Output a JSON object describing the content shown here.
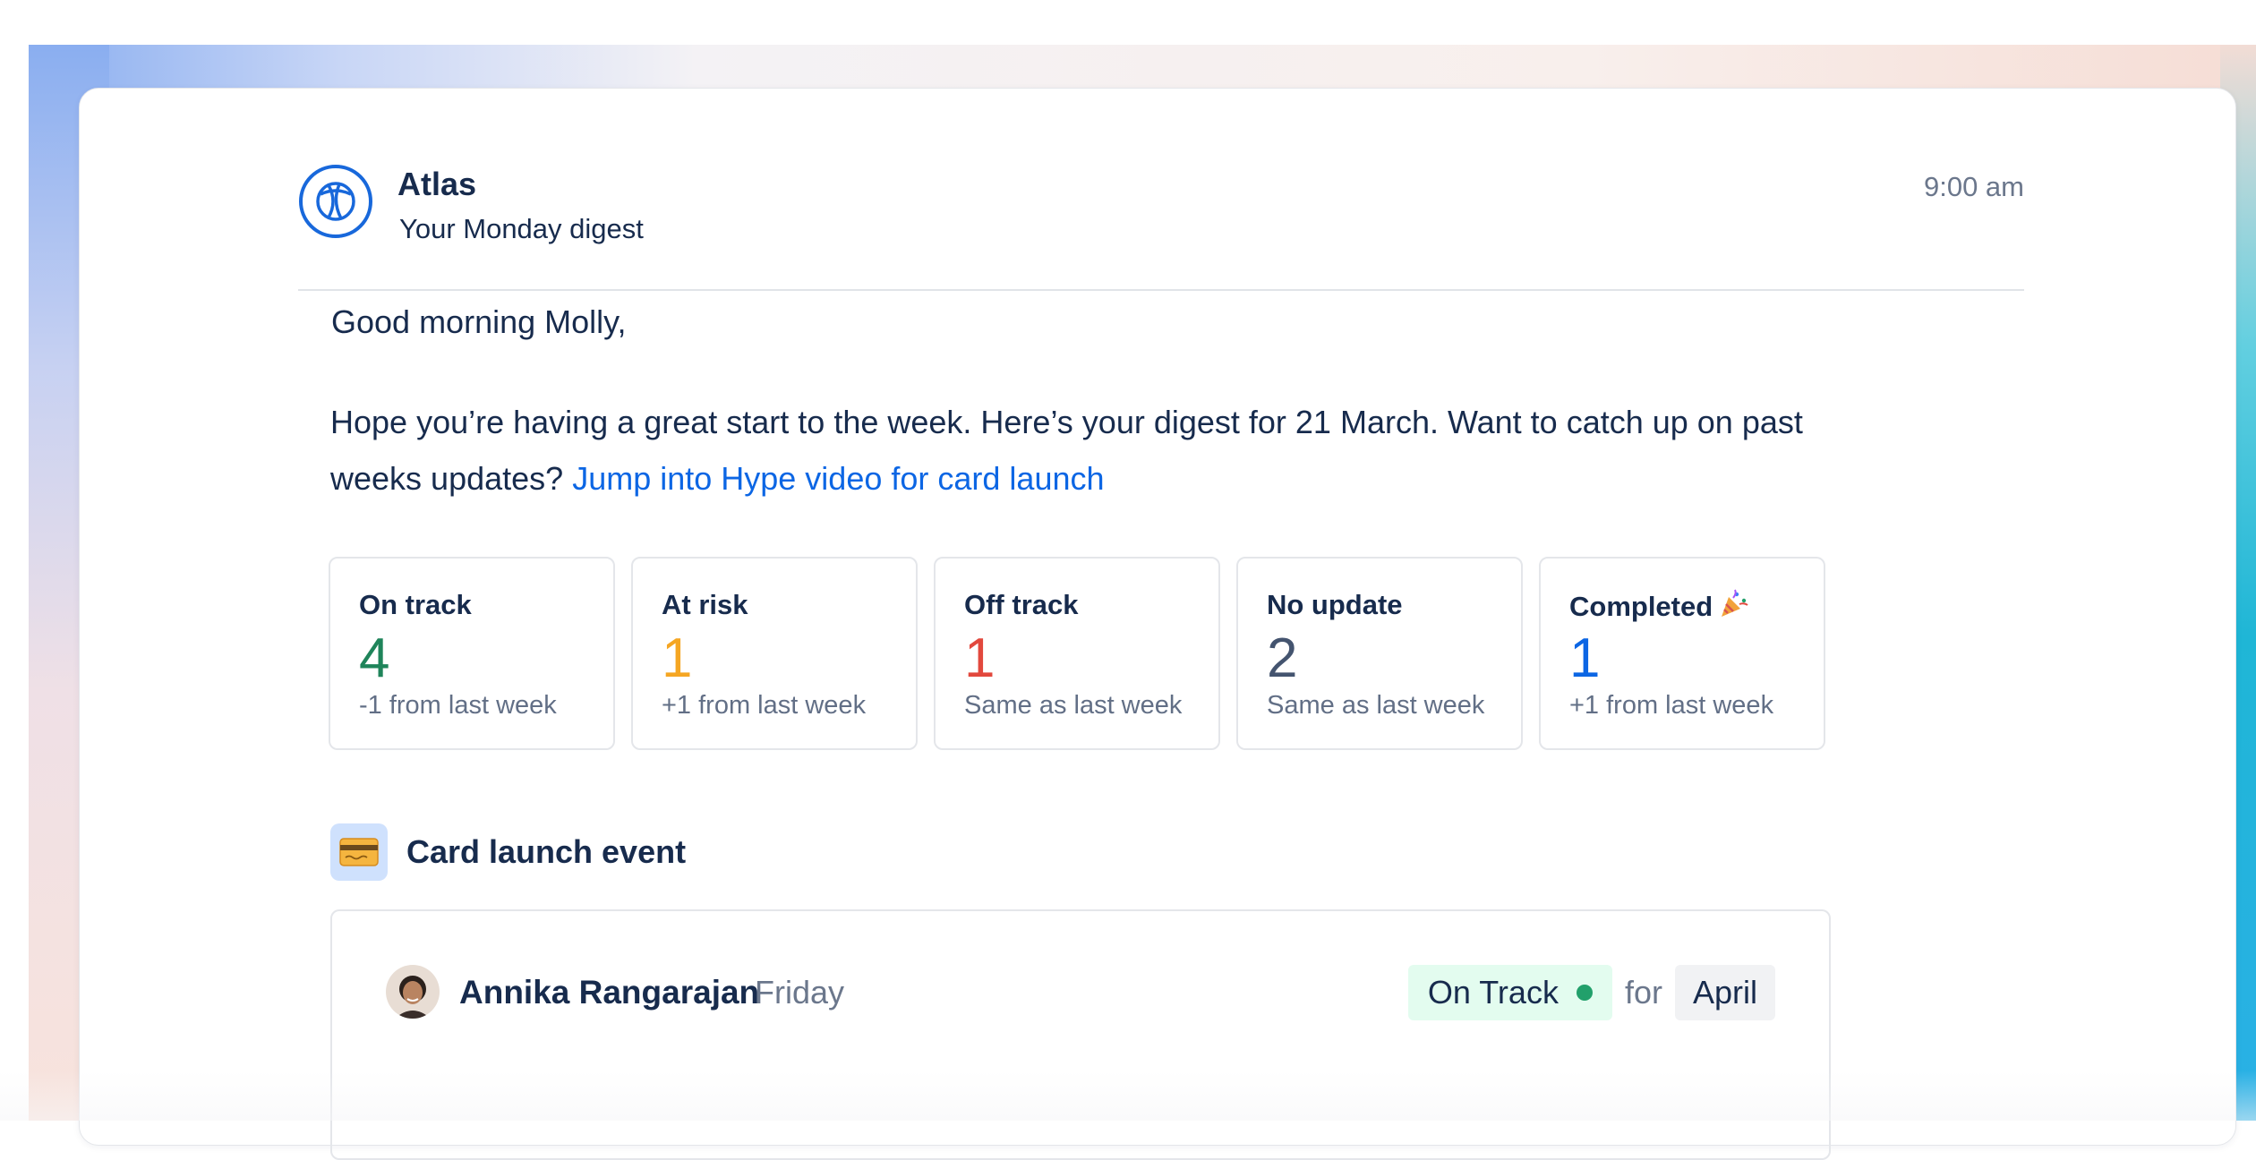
{
  "header": {
    "app_name": "Atlas",
    "subtitle": "Your Monday digest",
    "time": "9:00 am"
  },
  "message": {
    "greeting": "Good morning Molly,",
    "intro": "Hope you’re having a great start to the week. Here’s your digest for 21 March. Want to catch up on past weeks updates? ",
    "link_text": "Jump into Hype video for card launch"
  },
  "stats": [
    {
      "label": "On track",
      "value": "4",
      "change": "-1 from last week",
      "color": "#1f845a"
    },
    {
      "label": "At risk",
      "value": "1",
      "change": "+1 from last week",
      "color": "#f5a623"
    },
    {
      "label": "Off track",
      "value": "1",
      "change": "Same as last week",
      "color": "#e2483d"
    },
    {
      "label": "No update",
      "value": "2",
      "change": "Same as last week",
      "color": "#44546f"
    },
    {
      "label": "Completed",
      "value": "1",
      "change": "+1 from last week",
      "color": "#0c66e4",
      "icon": "party-popper-icon"
    }
  ],
  "project": {
    "icon": "credit-card-icon",
    "title": "Card launch event"
  },
  "update": {
    "author": "Annika Rangarajan",
    "day": "Friday",
    "status": "On Track",
    "status_color": "#22a06b",
    "for_label": "for",
    "period": "April"
  }
}
